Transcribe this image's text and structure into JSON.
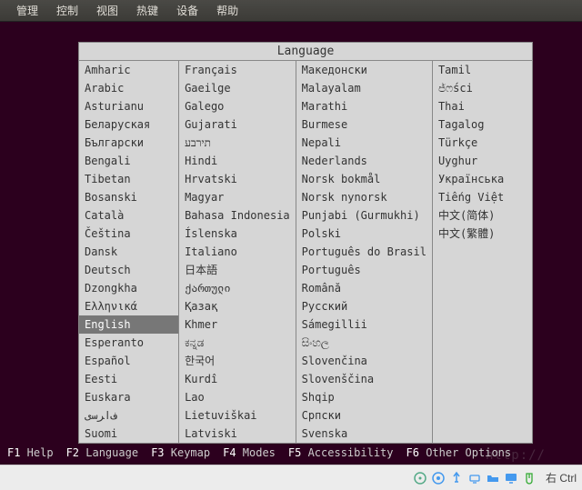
{
  "menubar": {
    "items": [
      "管理",
      "控制",
      "视图",
      "热键",
      "设备",
      "帮助"
    ]
  },
  "language_panel": {
    "title": "Language",
    "selected": "English",
    "columns": [
      [
        "Amharic",
        "Arabic",
        "Asturianu",
        "Беларуская",
        "Български",
        "Bengali",
        "Tibetan",
        "Bosanski",
        "Català",
        "Čeština",
        "Dansk",
        "Deutsch",
        "Dzongkha",
        "Ελληνικά",
        "English",
        "Esperanto",
        "Español",
        "Eesti",
        "Euskara",
        "ﻑﺍﺮﺳی",
        "Suomi"
      ],
      [
        "Français",
        "Gaeilge",
        "Galego",
        "Gujarati",
        "תירבע",
        "Hindi",
        "Hrvatski",
        "Magyar",
        "Bahasa Indonesia",
        "Íslenska",
        "Italiano",
        "日本語",
        "ქართული",
        "Қазақ",
        "Khmer",
        "ಕನ್ನಡ",
        "한국어",
        "Kurdî",
        "Lao",
        "Lietuviškai",
        "Latviski"
      ],
      [
        "Македонски",
        "Malayalam",
        "Marathi",
        "Burmese",
        "Nepali",
        "Nederlands",
        "Norsk bokmål",
        "Norsk nynorsk",
        "Punjabi (Gurmukhi)",
        "Polski",
        "Português do Brasil",
        "Português",
        "Română",
        "Русский",
        "Sámegillii",
        "සිංහල",
        "Slovenčina",
        "Slovenščina",
        "Shqip",
        "Српски",
        "Svenska"
      ],
      [
        "Tamil",
        "ජ්ෆści",
        "Thai",
        "Tagalog",
        "Türkçe",
        "Uyghur",
        "Українська",
        "Tiếng Việt",
        "中文(简体)",
        "中文(繁體)"
      ]
    ]
  },
  "fkeys": [
    {
      "key": "F1",
      "label": "Help"
    },
    {
      "key": "F2",
      "label": "Language"
    },
    {
      "key": "F3",
      "label": "Keymap"
    },
    {
      "key": "F4",
      "label": "Modes"
    },
    {
      "key": "F5",
      "label": "Accessibility"
    },
    {
      "key": "F6",
      "label": "Other Options"
    }
  ],
  "statusbar": {
    "host_key": "右 Ctrl"
  },
  "watermark": "http://"
}
